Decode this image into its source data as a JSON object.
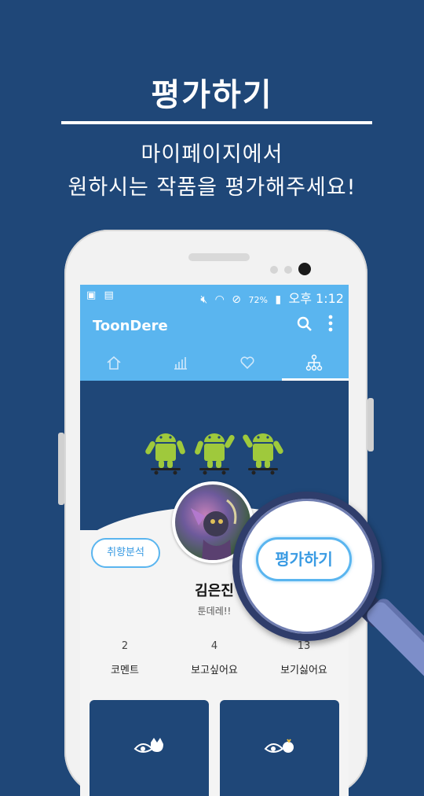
{
  "promo": {
    "headline": "평가하기",
    "subtitle_line1": "마이페이지에서",
    "subtitle_line2": "원하시는 작품을 평가해주세요!"
  },
  "status_bar": {
    "battery": "72%",
    "time": "오후 1:12",
    "icons": [
      "image-icon",
      "notification-icon",
      "mute-icon",
      "wifi-icon",
      "no-disturb-icon",
      "battery-charging-icon"
    ]
  },
  "app_bar": {
    "title": "ToonDere",
    "icons": [
      "search-icon",
      "more-vertical-icon"
    ]
  },
  "tabs": [
    {
      "icon": "home-icon"
    },
    {
      "icon": "chart-icon"
    },
    {
      "icon": "heart-icon"
    },
    {
      "icon": "network-icon",
      "active": true
    }
  ],
  "profile": {
    "left_button": "취향분석",
    "right_button": "평가하기",
    "name": "김은진",
    "tagline": "툰데레!!"
  },
  "stats": [
    {
      "value": "2",
      "label": "코멘트"
    },
    {
      "value": "4",
      "label": "보고싶어요"
    },
    {
      "value": "13",
      "label": "보기싫어요"
    }
  ],
  "colors": {
    "background": "#1f4778",
    "accent": "#5ab5ef",
    "android_green": "#9fc93c"
  }
}
